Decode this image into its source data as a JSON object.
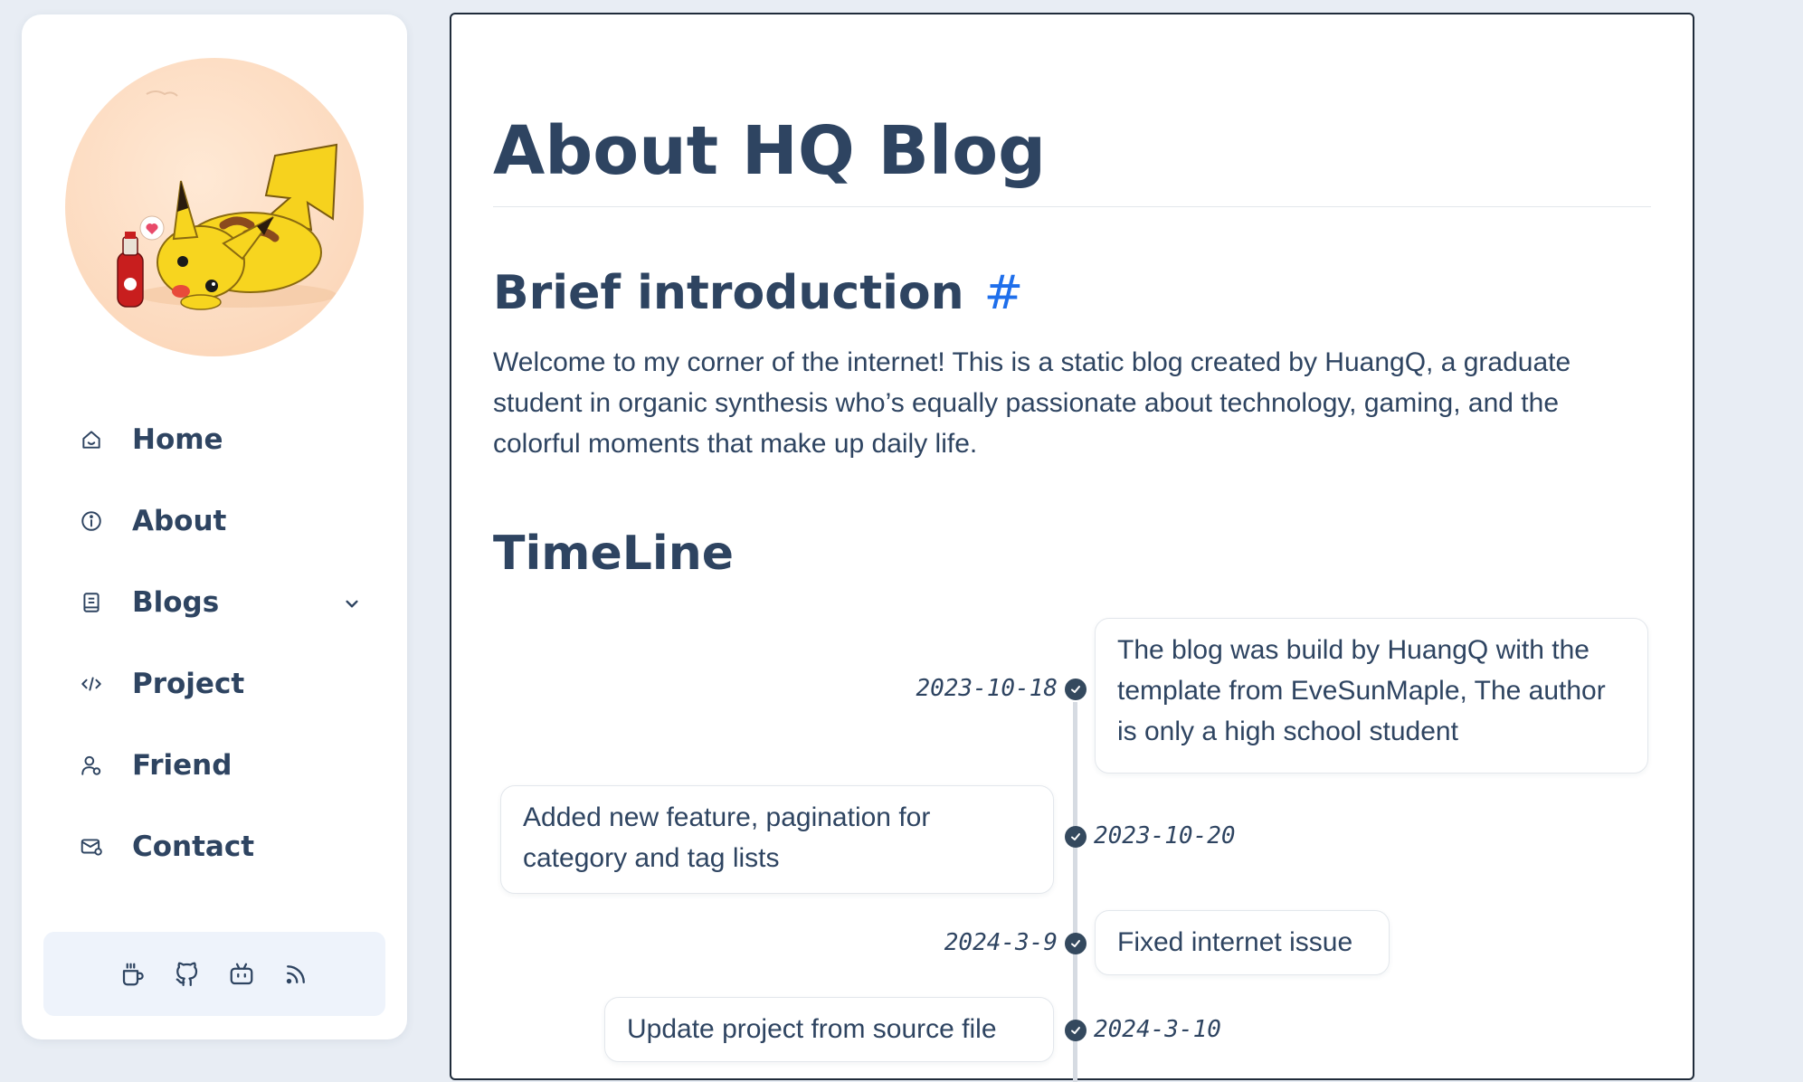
{
  "sidebar": {
    "nav": [
      {
        "label": "Home",
        "icon": "home-icon"
      },
      {
        "label": "About",
        "icon": "info-icon"
      },
      {
        "label": "Blogs",
        "icon": "book-icon"
      },
      {
        "label": "Project",
        "icon": "code-icon"
      },
      {
        "label": "Friend",
        "icon": "friend-icon"
      },
      {
        "label": "Contact",
        "icon": "contact-mail-icon"
      }
    ],
    "social_icons": [
      "coffee-icon",
      "github-icon",
      "bilibili-icon",
      "rss-icon"
    ]
  },
  "main": {
    "title": "About HQ Blog",
    "intro_heading": "Brief introduction",
    "anchor_symbol": "#",
    "intro_text": "Welcome to my corner of the internet! This is a static blog created by HuangQ, a graduate student in organic synthesis who’s equally passionate about technology, gaming, and the colorful moments that make up daily life.",
    "timeline_heading": "TimeLine",
    "timeline": [
      {
        "date": "2023-10-18",
        "text": "The blog was build by HuangQ with the template from EveSunMaple, The author is only a high school student"
      },
      {
        "date": "2023-10-20",
        "text": "Added new feature, pagination for category and tag lists"
      },
      {
        "date": "2024-3-9",
        "text": "Fixed internet issue"
      },
      {
        "date": "2024-3-10",
        "text": "Update project from source file"
      }
    ]
  },
  "colors": {
    "background": "#e8edf4",
    "text": "#2e4461",
    "accent_link": "#1f6feb",
    "social_bar": "#eef3fb"
  }
}
